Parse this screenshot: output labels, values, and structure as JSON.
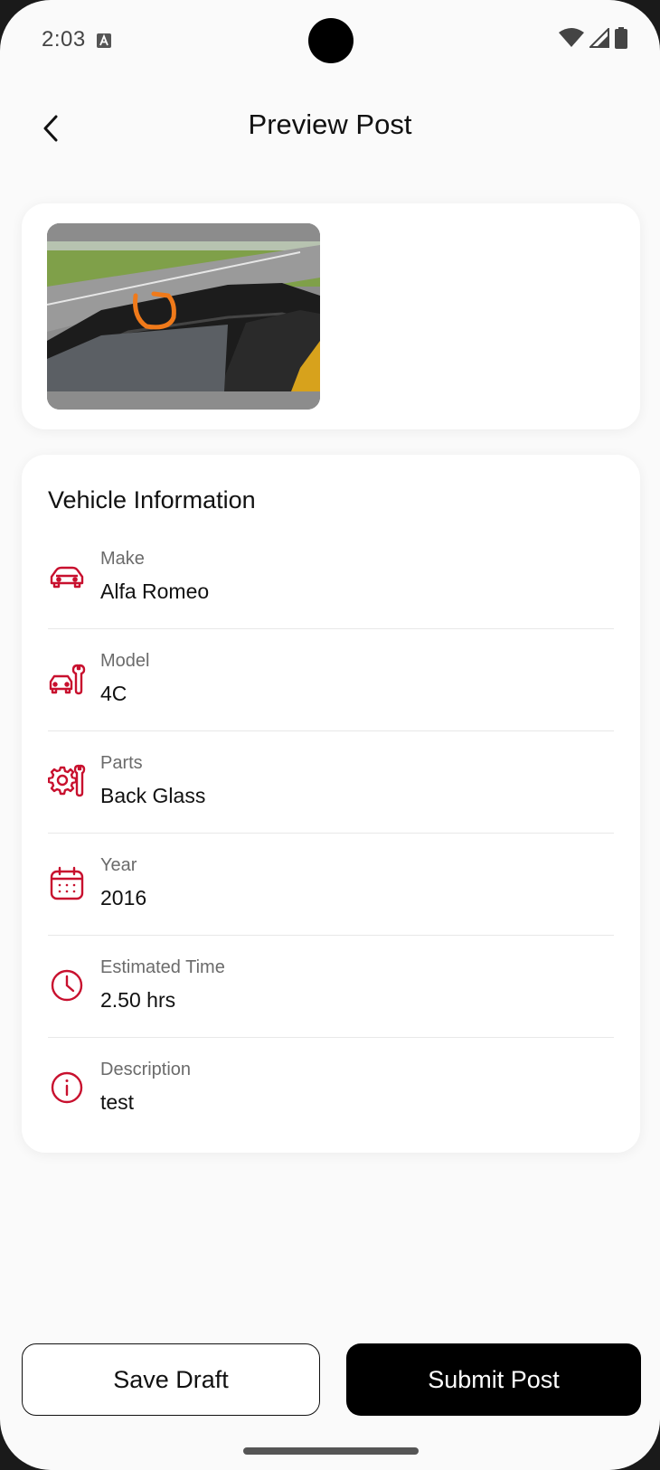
{
  "status_bar": {
    "time": "2:03"
  },
  "header": {
    "title": "Preview Post"
  },
  "vehicle_info": {
    "title": "Vehicle Information",
    "rows": [
      {
        "icon": "car-icon",
        "label": "Make",
        "value": "Alfa Romeo"
      },
      {
        "icon": "car-repair-icon",
        "label": "Model",
        "value": "4C"
      },
      {
        "icon": "gear-wrench-icon",
        "label": "Parts",
        "value": "Back Glass"
      },
      {
        "icon": "calendar-icon",
        "label": "Year",
        "value": "2016"
      },
      {
        "icon": "clock-icon",
        "label": "Estimated Time",
        "value": "2.50 hrs"
      },
      {
        "icon": "info-icon",
        "label": "Description",
        "value": "test"
      }
    ]
  },
  "actions": {
    "save_draft": "Save Draft",
    "submit_post": "Submit Post"
  },
  "colors": {
    "accent": "#c8102e",
    "annotation": "#f07a1a"
  }
}
